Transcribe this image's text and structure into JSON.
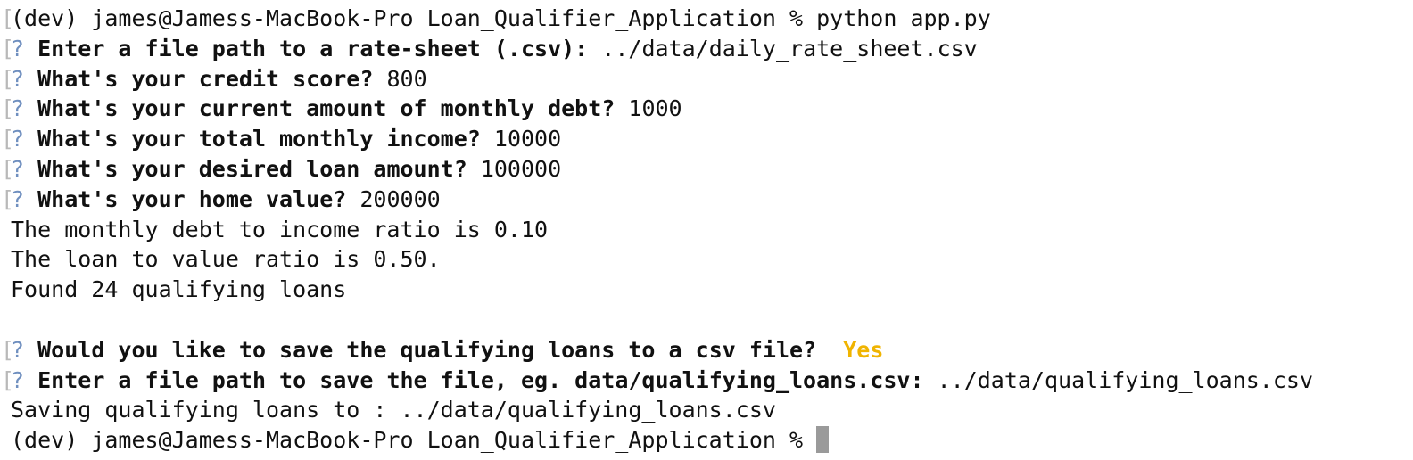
{
  "terminal": {
    "bracket_glyph": "[",
    "prompt_marker": "?",
    "first_command": {
      "prompt": "(dev) james@Jamess-MacBook-Pro Loan_Qualifier_Application %",
      "command": "python app.py"
    },
    "questions": [
      {
        "question": "Enter a file path to a rate-sheet (.csv):",
        "answer": "../data/daily_rate_sheet.csv"
      },
      {
        "question": "What's your credit score?",
        "answer": "800"
      },
      {
        "question": "What's your current amount of monthly debt?",
        "answer": "1000"
      },
      {
        "question": "What's your total monthly income?",
        "answer": "10000"
      },
      {
        "question": "What's your desired loan amount?",
        "answer": "100000"
      },
      {
        "question": "What's your home value?",
        "answer": "200000"
      }
    ],
    "results": [
      "The monthly debt to income ratio is 0.10",
      "The loan to value ratio is 0.50.",
      "Found 24 qualifying loans"
    ],
    "save_prompt": {
      "question": "Would you like to save the qualifying loans to a csv file?",
      "answer": "Yes"
    },
    "path_prompt": {
      "question": "Enter a file path to save the file, eg. data/qualifying_loans.csv:",
      "answer": "../data/qualifying_loans.csv"
    },
    "saving_message": "Saving qualifying loans to : ../data/qualifying_loans.csv",
    "final_prompt": "(dev) james@Jamess-MacBook-Pro Loan_Qualifier_Application %",
    "colors": {
      "background": "#ffffff",
      "text": "#111111",
      "question_mark": "#6f8fbf",
      "bracket": "#b9b9b9",
      "yes_answer": "#f0b400",
      "cursor": "#9a9a9a"
    }
  }
}
